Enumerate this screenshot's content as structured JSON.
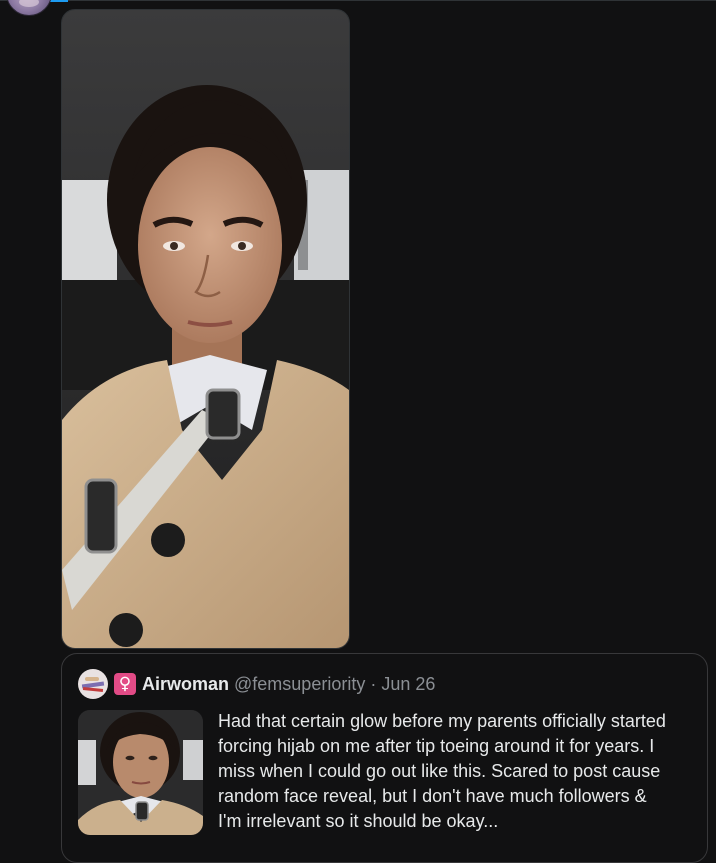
{
  "quote_tweet": {
    "author_name": "Airwoman",
    "author_handle": "@femsuperiority",
    "separator": "·",
    "date": "Jun 26",
    "badge_icon": "female-sign-icon",
    "badge_glyph": "♀",
    "badge_color": "#e24b86",
    "text": "Had that certain glow before my parents officially started\nforcing hijab on me after tip toeing around it for years. I\nmiss when I could go out like this. Scared to post cause\nrandom face reveal, but I don't have much followers &\nI'm irrelevant so it should be okay..."
  },
  "theme": {
    "background": "#111112",
    "accent": "#1d9bf0",
    "muted_text": "#8b8f94"
  }
}
